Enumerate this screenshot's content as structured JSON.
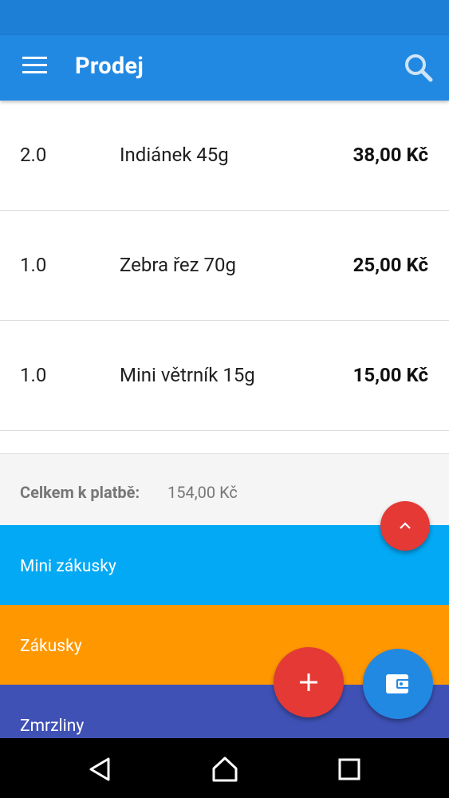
{
  "app_bar": {
    "title": "Prodej",
    "menu_icon": "hamburger-menu-icon",
    "search_icon": "search-icon",
    "color": "#2289e3"
  },
  "items": [
    {
      "qty": "2.0",
      "name": "Indiánek 45g",
      "price": "38,00 Kč"
    },
    {
      "qty": "1.0",
      "name": "Zebra řez 70g",
      "price": "25,00 Kč"
    },
    {
      "qty": "1.0",
      "name": "Mini větrník 15g",
      "price": "15,00 Kč"
    }
  ],
  "total": {
    "label": "Celkem k platbě:",
    "value": "154,00 Kč"
  },
  "categories": [
    {
      "label": "Mini zákusky",
      "color": "#03a9f4"
    },
    {
      "label": "Zákusky",
      "color": "#ff9800"
    },
    {
      "label": "Zmrzliny",
      "color": "#3f51b5"
    }
  ],
  "fabs": {
    "scroll_up_icon": "chevron-up-icon",
    "add_icon": "plus-icon",
    "pay_icon": "wallet-icon"
  },
  "nav": {
    "back_icon": "back-icon",
    "home_icon": "home-icon",
    "recents_icon": "recents-icon"
  }
}
